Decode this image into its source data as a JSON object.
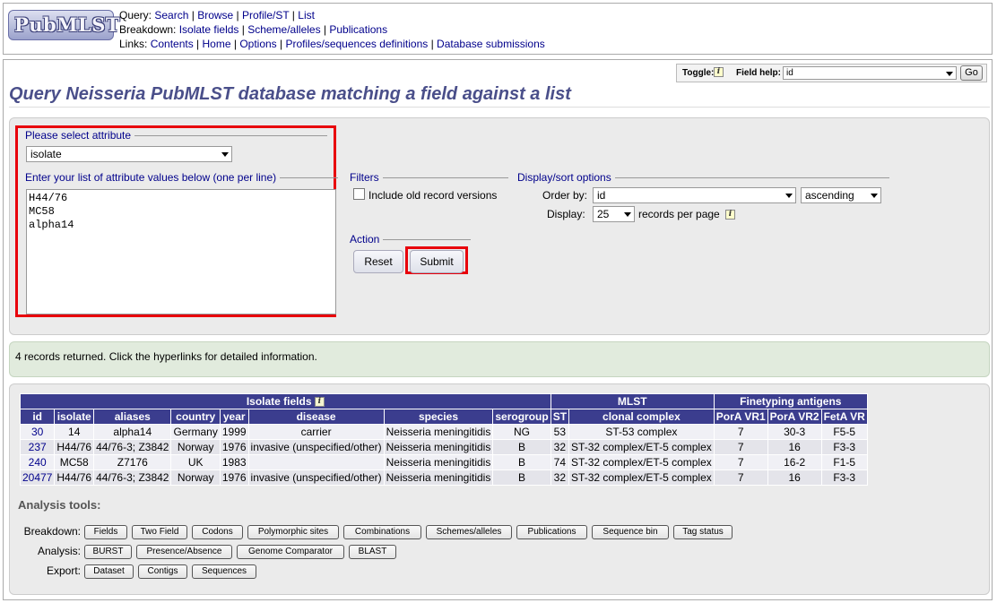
{
  "logo": {
    "text": "PubMLST"
  },
  "menu": {
    "query": {
      "prefix": "Query: ",
      "items": [
        "Search",
        "Browse",
        "Profile/ST",
        "List"
      ]
    },
    "breakdown": {
      "prefix": "Breakdown: ",
      "items": [
        "Isolate fields",
        "Scheme/alleles",
        "Publications"
      ]
    },
    "links": {
      "prefix": "Links: ",
      "items": [
        "Contents",
        "Home",
        "Options",
        "Profiles/sequences definitions",
        "Database submissions"
      ]
    }
  },
  "toolbar": {
    "toggle_label": "Toggle:",
    "field_help_label": "Field help:",
    "field_help_value": "id",
    "go_label": "Go"
  },
  "page": {
    "title": "Query Neisseria PubMLST database matching a field against a list"
  },
  "form": {
    "attribute_legend": "Please select attribute",
    "attribute_value": "isolate",
    "values_legend": "Enter your list of attribute values below (one per line)",
    "values_text": "H44/76\nMC58\nalpha14",
    "filters_legend": "Filters",
    "old_versions_label": "Include old record versions",
    "old_versions_checked": false,
    "display_legend": "Display/sort options",
    "order_by_label": "Order by:",
    "order_by_value": "id",
    "order_dir_value": "ascending",
    "display_label": "Display:",
    "display_value": "25",
    "records_per_page": "records per page",
    "action_legend": "Action",
    "reset_label": "Reset",
    "submit_label": "Submit"
  },
  "results": {
    "summary": "4 records returned. Click the hyperlinks for detailed information.",
    "groups": {
      "isolate_fields": "Isolate fields",
      "mlst": "MLST",
      "finetyping": "Finetyping antigens"
    },
    "columns": [
      "id",
      "isolate",
      "aliases",
      "country",
      "year",
      "disease",
      "species",
      "serogroup",
      "ST",
      "clonal complex",
      "PorA VR1",
      "PorA VR2",
      "FetA VR"
    ],
    "rows": [
      [
        "30",
        "14",
        "alpha14",
        "Germany",
        "1999",
        "carrier",
        "Neisseria meningitidis",
        "NG",
        "53",
        "ST-53 complex",
        "7",
        "30-3",
        "F5-5"
      ],
      [
        "237",
        "H44/76",
        "44/76-3; Z3842",
        "Norway",
        "1976",
        "invasive (unspecified/other)",
        "Neisseria meningitidis",
        "B",
        "32",
        "ST-32 complex/ET-5 complex",
        "7",
        "16",
        "F3-3"
      ],
      [
        "240",
        "MC58",
        "Z7176",
        "UK",
        "1983",
        "",
        "Neisseria meningitidis",
        "B",
        "74",
        "ST-32 complex/ET-5 complex",
        "7",
        "16-2",
        "F1-5"
      ],
      [
        "20477",
        "H44/76",
        "44/76-3; Z3842",
        "Norway",
        "1976",
        "invasive (unspecified/other)",
        "Neisseria meningitidis",
        "B",
        "32",
        "ST-32 complex/ET-5 complex",
        "7",
        "16",
        "F3-3"
      ]
    ]
  },
  "tools": {
    "title": "Analysis tools:",
    "breakdown_label": "Breakdown:",
    "breakdown": [
      "Fields",
      "Two Field",
      "Codons",
      "Polymorphic sites",
      "Combinations",
      "Schemes/alleles",
      "Publications",
      "Sequence bin",
      "Tag status"
    ],
    "analysis_label": "Analysis:",
    "analysis": [
      "BURST",
      "Presence/Absence",
      "Genome Comparator",
      "BLAST"
    ],
    "export_label": "Export:",
    "export": [
      "Dataset",
      "Contigs",
      "Sequences"
    ]
  },
  "colors": {
    "header_blue": "#3b3d8e",
    "link_blue": "#00008b",
    "title_blue": "#4a4f8a",
    "highlight_red": "#e8000b",
    "result_green": "#e1ebdd"
  }
}
